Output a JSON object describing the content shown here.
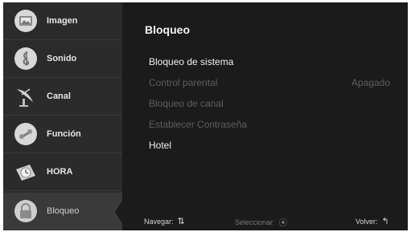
{
  "sidebar": {
    "items": [
      {
        "label": "Imagen",
        "icon": "image-icon"
      },
      {
        "label": "Sonido",
        "icon": "music-note-icon"
      },
      {
        "label": "Canal",
        "icon": "satellite-dish-icon"
      },
      {
        "label": "Función",
        "icon": "tools-icon"
      },
      {
        "label": "HORA",
        "icon": "clock-icon"
      },
      {
        "label": "Bloqueo",
        "icon": "padlock-icon",
        "active": true
      }
    ]
  },
  "main": {
    "title": "Bloqueo",
    "rows": [
      {
        "label": "Bloqueo de sistema",
        "value": "",
        "enabled": true
      },
      {
        "label": "Control parental",
        "value": "Apagado",
        "enabled": false
      },
      {
        "label": "Bloqueo de canal",
        "value": "",
        "enabled": false
      },
      {
        "label": "Establecer Contraseña",
        "value": "",
        "enabled": false
      },
      {
        "label": "Hotel",
        "value": "",
        "enabled": true
      }
    ]
  },
  "footer": {
    "navigate": "Navegar:",
    "select": "Seleccionar:",
    "back": "Volver:"
  },
  "colors": {
    "background": "#1b1b1b",
    "sidebar": "#2b2b2b",
    "text": "#f0f0f0",
    "disabled_text": "#5e5e5e"
  }
}
